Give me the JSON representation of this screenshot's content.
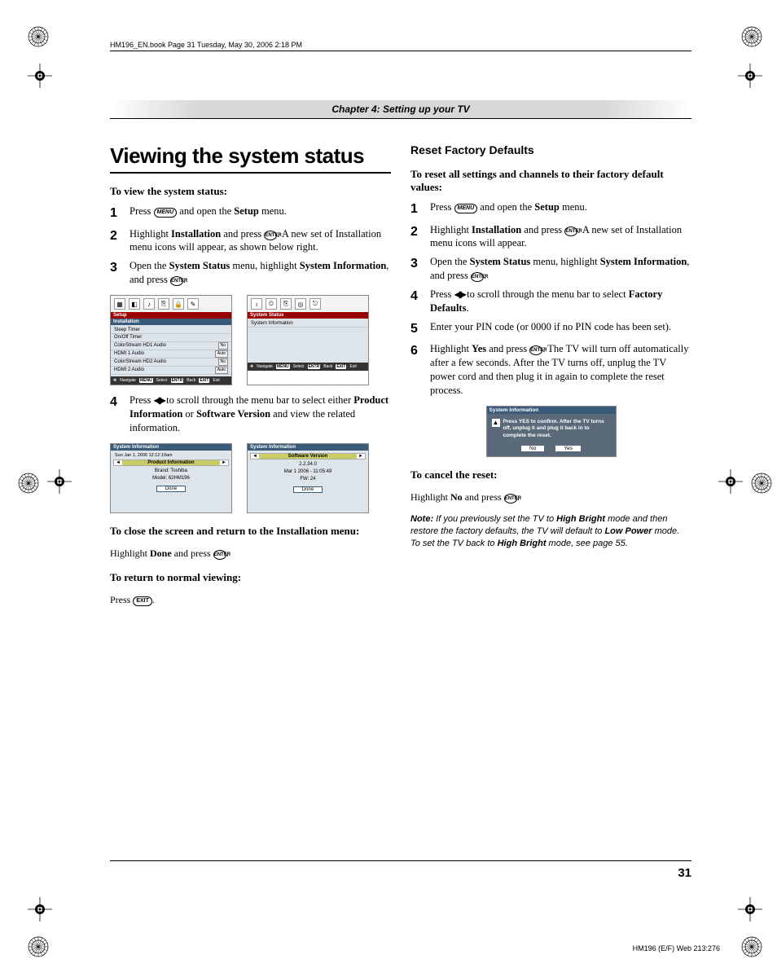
{
  "header": {
    "runhead": "HM196_EN.book  Page 31  Tuesday, May 30, 2006  2:18 PM",
    "chapter": "Chapter 4: Setting up your TV"
  },
  "buttons": {
    "menu": "MENU",
    "enter": "ENTER",
    "exit": "EXIT"
  },
  "left": {
    "h1": "Viewing the system status",
    "lead1": "To view the system status:",
    "step1_a": "Press ",
    "step1_b": " and open the ",
    "step1_c": "Setup",
    "step1_d": " menu.",
    "step2_a": "Highlight ",
    "step2_b": "Installation",
    "step2_c": " and press ",
    "step2_d": ". A new set of Installation menu icons will appear, as shown below right.",
    "step3_a": "Open the ",
    "step3_b": "System Status",
    "step3_c": " menu, highlight ",
    "step3_d": "System Information",
    "step3_e": ", and press ",
    "step3_f": ".",
    "step4_a": "Press ",
    "step4_b": " to scroll through the menu bar to select either ",
    "step4_c": "Product Information",
    "step4_d": " or ",
    "step4_e": "Software Version",
    "step4_f": " and view the related information.",
    "close_h": "To close the screen and return to the Installation menu:",
    "close_a": "Highlight ",
    "close_b": "Done",
    "close_c": " and press ",
    "close_d": ".",
    "return_h": "To return to normal viewing:",
    "return_a": "Press ",
    "return_b": "."
  },
  "right": {
    "h2": "Reset Factory Defaults",
    "lead1": "To reset all settings and channels to their factory default values:",
    "step1_a": "Press ",
    "step1_b": " and open the ",
    "step1_c": "Setup",
    "step1_d": " menu.",
    "step2_a": "Highlight ",
    "step2_b": "Installation",
    "step2_c": " and press ",
    "step2_d": ". A new set of Installation menu icons will appear.",
    "step3_a": "Open the ",
    "step3_b": "System Status",
    "step3_c": " menu, highlight ",
    "step3_d": "System Information",
    "step3_e": ", and press ",
    "step3_f": ".",
    "step4_a": "Press ",
    "step4_b": " to scroll through the menu bar to select ",
    "step4_c": "Factory Defaults",
    "step4_d": ".",
    "step5": "Enter your PIN code (or 0000 if no PIN code has been set).",
    "step6_a": "Highlight ",
    "step6_b": "Yes",
    "step6_c": " and press ",
    "step6_d": ". The TV will turn off automatically after a few seconds. After the TV turns off, unplug the TV power cord and then plug it in again to complete the reset process.",
    "cancel_h": "To cancel the reset:",
    "cancel_a": "Highlight ",
    "cancel_b": "No",
    "cancel_c": " and press ",
    "cancel_d": ".",
    "note_label": "Note:",
    "note_a": " If you previously set the TV to ",
    "note_b": "High Bright",
    "note_c": " mode and then restore the factory defaults, the TV will default to ",
    "note_d": "Low Power",
    "note_e": " mode. To set the TV back to ",
    "note_f": "High Bright",
    "note_g": " mode, see page 55."
  },
  "osd_setup": {
    "title": "Setup",
    "sub": "Installation",
    "rows": [
      {
        "l": "Sleep Timer",
        "r": ""
      },
      {
        "l": "On/Off Timer",
        "r": ""
      },
      {
        "l": "ColorStream HD1 Audio",
        "r": "No"
      },
      {
        "l": "HDMI 1 Audio",
        "r": "Auto"
      },
      {
        "l": "ColorStream HD2 Audio",
        "r": "No"
      },
      {
        "l": "HDMI 2 Audio",
        "r": "Auto"
      }
    ],
    "footer": [
      "Navigate",
      "MENU",
      "Select",
      "ENTR",
      "Back",
      "EXIT",
      "Exit"
    ]
  },
  "osd_status": {
    "title": "System Status",
    "row": "System Information",
    "footer": [
      "Navigate",
      "MENU",
      "Select",
      "ENTR",
      "Back",
      "EXIT",
      "Exit"
    ]
  },
  "osd_prod": {
    "title": "System Information",
    "date": "Sun Jan 1, 2006   12:12:19am",
    "bar": "Product Information",
    "l1": "Brand:  Toshiba",
    "l2": "Model:  62HM196",
    "done": "Done"
  },
  "osd_soft": {
    "title": "System Information",
    "bar": "Software Version",
    "l1": "2.2.34.0",
    "l2": "Mar 1 2006 - 11:05:49",
    "l3": "FW: 24",
    "done": "Done"
  },
  "osd_confirm": {
    "title": "System Information",
    "msg": "Press YES to confirm. After the TV turns off, unplug it and plug it back in to complete the reset.",
    "no": "No",
    "yes": "Yes"
  },
  "page_num": "31",
  "footer_code": "HM196 (E/F) Web 213:276"
}
